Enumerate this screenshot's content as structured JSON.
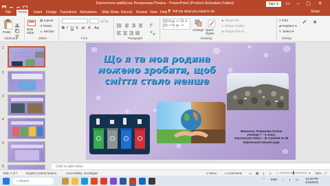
{
  "window": {
    "title": "Екологічне майбутнє Розмочева Поліна - PowerPoint (Product Activation Failed)",
    "sign_in": "Sign in"
  },
  "tabs": [
    "File",
    "Home",
    "Insert",
    "Design",
    "Transitions",
    "Animations",
    "Slide Show",
    "Record",
    "Review",
    "View",
    "Help"
  ],
  "active_tab": "Home",
  "tell_me": "Tell me what you want to do",
  "share": "Share",
  "ribbon": {
    "clipboard": {
      "paste": "Paste",
      "label": "Clipboard"
    },
    "slides": {
      "new_slide": "New Slide",
      "layout": "Layout",
      "reset": "Reset",
      "section": "Section",
      "label": "Slides"
    },
    "font": {
      "label": "Font"
    },
    "paragraph": {
      "label": "Paragraph"
    },
    "drawing": {
      "arrange": "Arrange",
      "quick_styles": "Quick Styles",
      "shape_fill": "Shape Fill",
      "shape_outline": "Shape Outline",
      "shape_effects": "Shape Effects",
      "label": "Drawing"
    },
    "editing": {
      "find": "Find",
      "replace": "Replace",
      "select": "Select",
      "label": "Editing"
    }
  },
  "thumbnails": [
    "1",
    "2",
    "3",
    "4",
    "5",
    "6"
  ],
  "slide": {
    "title_lines": [
      "Що я та моя родина",
      "можемо зробити, щоб",
      "сміття стало менше"
    ],
    "author_lines": [
      "Виконала: Розмочева Поліна",
      "учениця 7 – А класу",
      "Херсонської ЗОШ I – III ступенів № 39",
      "Херсонської міської ради"
    ]
  },
  "notes_placeholder": "Click to add notes",
  "status": {
    "slide_info": "Slide 1 of 7",
    "language": "English (United States)",
    "accessibility": "Accessibility: Investigate",
    "notes": "Notes",
    "comments": "Comments",
    "zoom": "65%"
  },
  "taskbar": {
    "search": "Search",
    "lang": "ENG",
    "time": "12:50 PM",
    "date": "4/15/2024"
  },
  "colors": {
    "accent": "#b7472a",
    "title_text": "#4aa6e8",
    "slide_bg": "#bba9d9"
  }
}
